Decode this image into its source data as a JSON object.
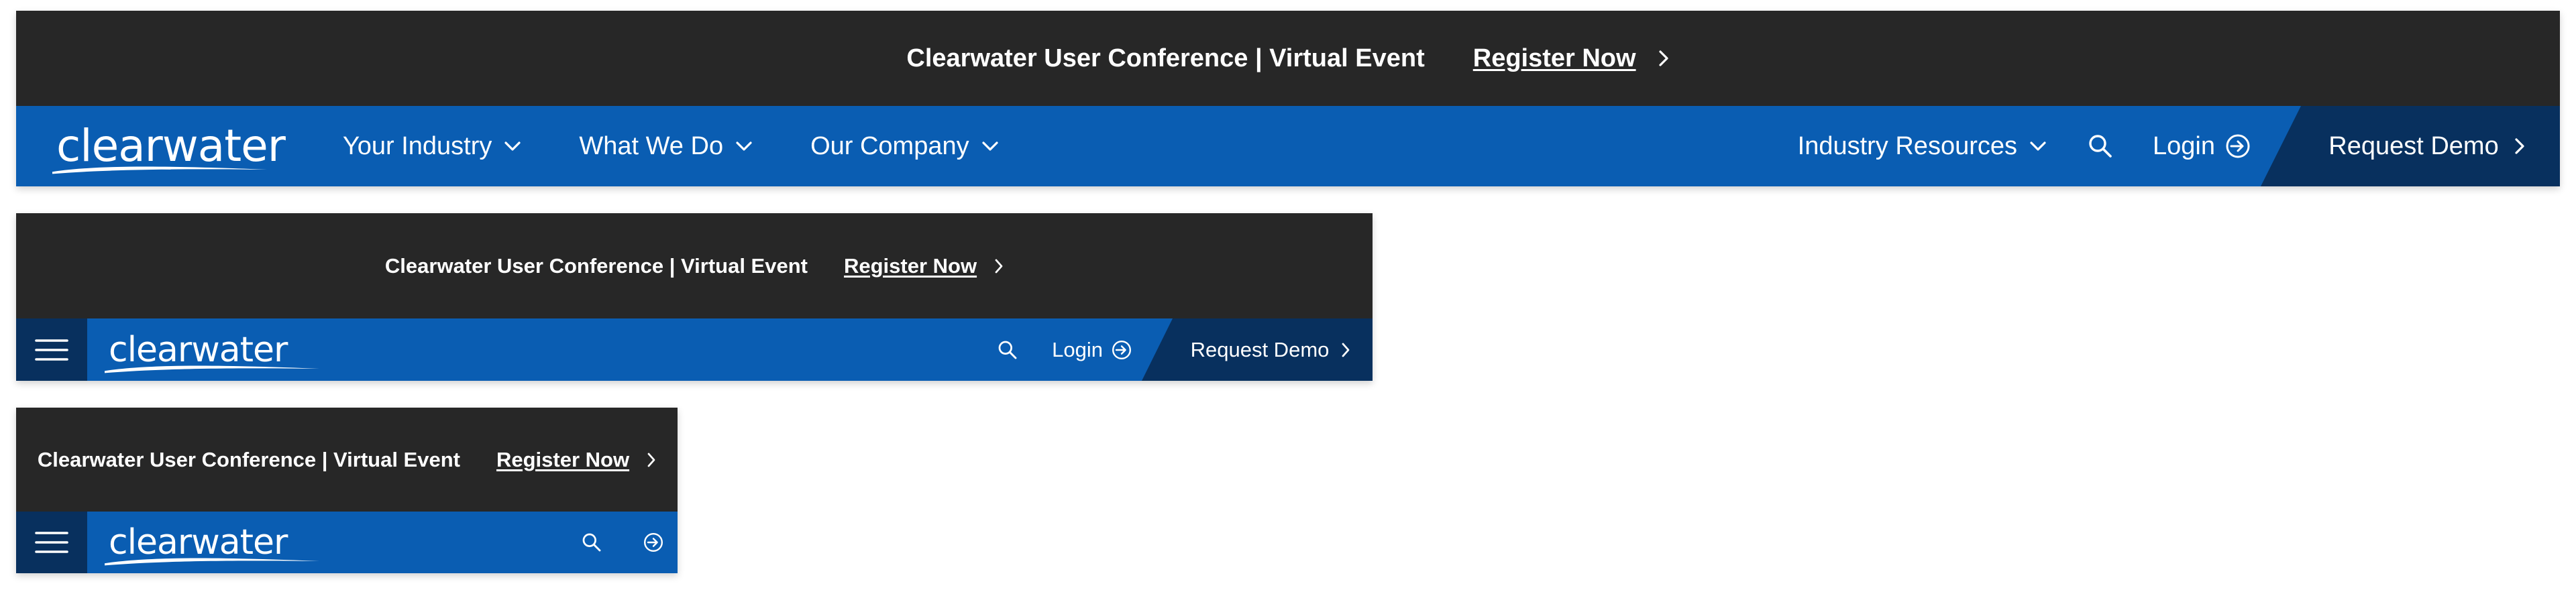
{
  "colors": {
    "banner_bg": "#272727",
    "nav_bg": "#0a5db2",
    "accent_dark": "#08305e",
    "text": "#ffffff"
  },
  "banner": {
    "message": "Clearwater User Conference | Virtual Event",
    "register_label": "Register Now",
    "arrow_icon": "chevron-right-icon"
  },
  "brand": {
    "logo_text": "clearwater"
  },
  "nav": {
    "items": [
      {
        "label": "Your Industry",
        "icon": "chevron-down-icon"
      },
      {
        "label": "What We Do",
        "icon": "chevron-down-icon"
      },
      {
        "label": "Our Company",
        "icon": "chevron-down-icon"
      }
    ],
    "resources_label": "Industry Resources",
    "search_icon": "search-icon",
    "login_label": "Login",
    "login_icon": "login-icon",
    "demo_label": "Request Demo",
    "menu_icon": "hamburger-menu-icon"
  }
}
